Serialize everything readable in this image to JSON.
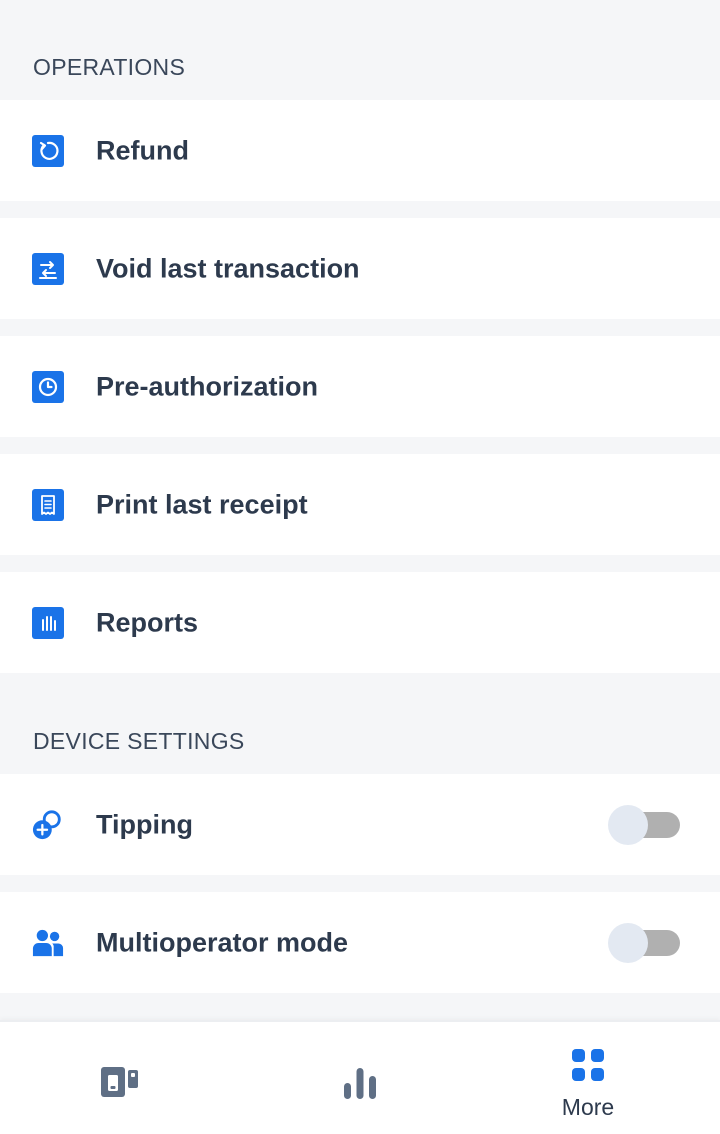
{
  "sections": {
    "operations": {
      "title": "OPERATIONS"
    },
    "device_settings": {
      "title": "DEVICE SETTINGS"
    }
  },
  "operations": {
    "items": [
      {
        "label": "Refund",
        "icon": "refund-icon"
      },
      {
        "label": "Void last transaction",
        "icon": "void-transaction-icon"
      },
      {
        "label": "Pre-authorization",
        "icon": "clock-icon"
      },
      {
        "label": "Print last receipt",
        "icon": "receipt-icon"
      },
      {
        "label": "Reports",
        "icon": "bar-chart-icon"
      }
    ]
  },
  "device_settings": {
    "items": [
      {
        "label": "Tipping",
        "icon": "tipping-icon",
        "enabled": false
      },
      {
        "label": "Multioperator mode",
        "icon": "users-icon",
        "enabled": false
      }
    ]
  },
  "bottom_nav": {
    "items": [
      {
        "label": "",
        "icon": "payment-terminal-icon",
        "active": false
      },
      {
        "label": "",
        "icon": "stats-icon",
        "active": false
      },
      {
        "label": "More",
        "icon": "grid-icon",
        "active": true
      }
    ]
  },
  "colors": {
    "accent": "#1a73e8",
    "text": "#2d3a4d",
    "background": "#f5f6f8",
    "nav_icon": "#5f6f85",
    "toggle_off_track": "#b0b0b0",
    "toggle_off_knob": "#e3e9f2"
  }
}
